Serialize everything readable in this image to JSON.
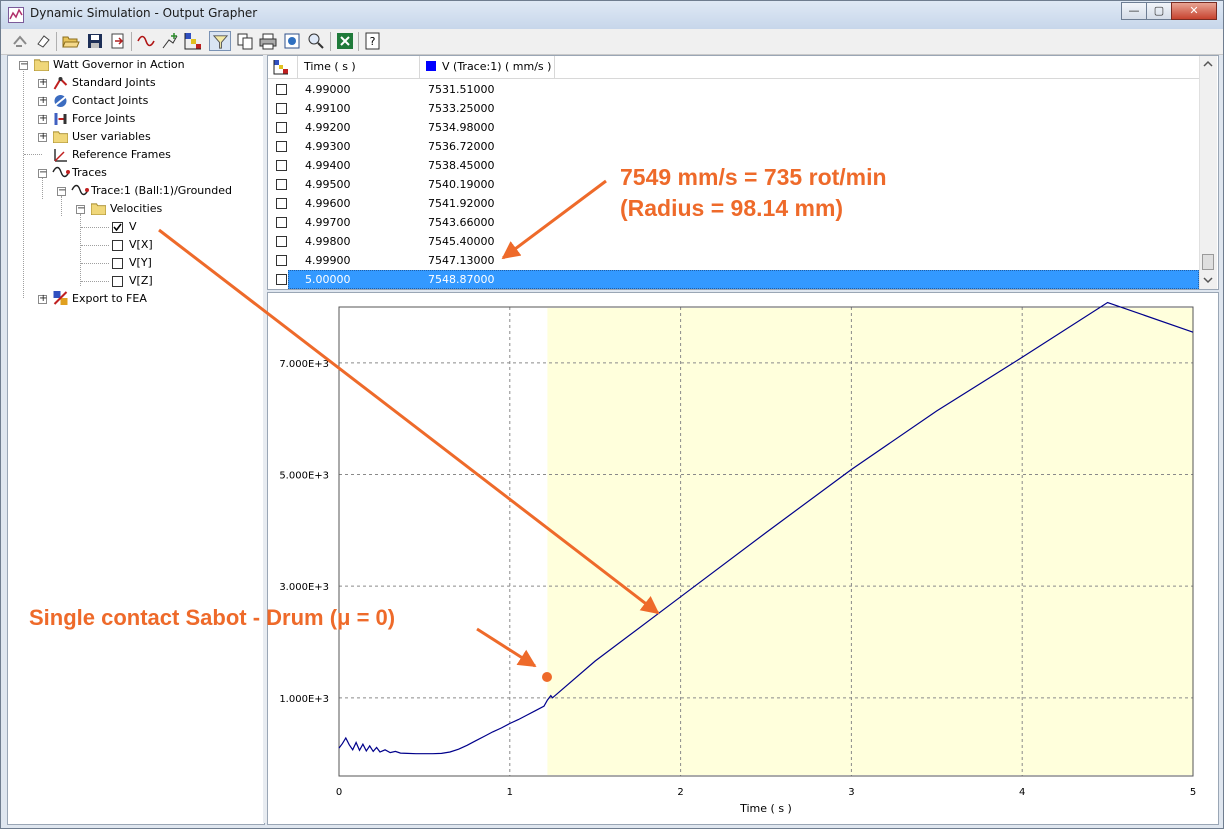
{
  "window": {
    "title": "Dynamic Simulation - Output Grapher",
    "controls": {
      "minimize": "—",
      "maximize": "▢",
      "close": "✕"
    }
  },
  "toolbar": {
    "icons": [
      "redo-icon",
      "eraser-icon",
      "open-folder-icon",
      "save-icon",
      "export-icon",
      "trace-icon",
      "add-variable-icon",
      "color-scale-icon",
      "filter-icon",
      "copy-icon",
      "print-icon",
      "zoom-fit-icon",
      "zoom-icon",
      "excel-icon",
      "help-icon"
    ],
    "active": "filter-icon"
  },
  "tree": {
    "root": "Watt Governor in Action",
    "items": [
      {
        "label": "Standard Joints",
        "icon": "standard-joints-icon"
      },
      {
        "label": "Contact Joints",
        "icon": "contact-joints-icon"
      },
      {
        "label": "Force Joints",
        "icon": "force-joints-icon"
      },
      {
        "label": "User variables",
        "icon": "folder-icon"
      },
      {
        "label": "Reference Frames",
        "icon": "reference-frame-icon"
      },
      {
        "label": "Traces",
        "icon": "trace-icon"
      },
      {
        "label": "Trace:1 (Ball:1)/Grounded",
        "icon": "trace-icon"
      },
      {
        "label": "Velocities",
        "icon": "folder-icon"
      },
      {
        "label": "V",
        "checked": true
      },
      {
        "label": "V[X]",
        "checked": false
      },
      {
        "label": "V[Y]",
        "checked": false
      },
      {
        "label": "V[Z]",
        "checked": false
      },
      {
        "label": "Export to FEA",
        "icon": "export-fea-icon"
      }
    ]
  },
  "table": {
    "columns": [
      "Time ( s )",
      "V (Trace:1) ( mm/s )"
    ],
    "series_color": "#0000ff",
    "rows": [
      {
        "time": "4.99000",
        "v": "7531.51000"
      },
      {
        "time": "4.99100",
        "v": "7533.25000"
      },
      {
        "time": "4.99200",
        "v": "7534.98000"
      },
      {
        "time": "4.99300",
        "v": "7536.72000"
      },
      {
        "time": "4.99400",
        "v": "7538.45000"
      },
      {
        "time": "4.99500",
        "v": "7540.19000"
      },
      {
        "time": "4.99600",
        "v": "7541.92000"
      },
      {
        "time": "4.99700",
        "v": "7543.66000"
      },
      {
        "time": "4.99800",
        "v": "7545.40000"
      },
      {
        "time": "4.99900",
        "v": "7547.13000"
      },
      {
        "time": "5.00000",
        "v": "7548.87000"
      }
    ],
    "selected_index": 10
  },
  "chart_data": {
    "type": "line",
    "title": "",
    "xlabel": "Time ( s )",
    "ylabel": "",
    "xlim": [
      0,
      5
    ],
    "ylim": [
      -400,
      8000
    ],
    "x_ticks": [
      "0",
      "1",
      "2",
      "3",
      "4",
      "5"
    ],
    "y_ticks": [
      {
        "value": 1000,
        "label": "1.000E+3"
      },
      {
        "value": 3000,
        "label": "3.000E+3"
      },
      {
        "value": 5000,
        "label": "5.000E+3"
      },
      {
        "value": 7000,
        "label": "7.000E+3"
      }
    ],
    "grid": true,
    "highlight_region": {
      "x_start": 1.22,
      "x_end": 5,
      "color": "#ffffdc"
    },
    "series": [
      {
        "color": "#00008b",
        "points": [
          [
            0,
            100
          ],
          [
            0.02,
            180
          ],
          [
            0.04,
            280
          ],
          [
            0.06,
            160
          ],
          [
            0.08,
            70
          ],
          [
            0.1,
            200
          ],
          [
            0.12,
            60
          ],
          [
            0.14,
            170
          ],
          [
            0.16,
            50
          ],
          [
            0.18,
            140
          ],
          [
            0.2,
            40
          ],
          [
            0.22,
            110
          ],
          [
            0.24,
            30
          ],
          [
            0.27,
            70
          ],
          [
            0.3,
            20
          ],
          [
            0.33,
            40
          ],
          [
            0.36,
            10
          ],
          [
            0.4,
            5
          ],
          [
            0.45,
            0
          ],
          [
            0.55,
            0
          ],
          [
            0.6,
            5
          ],
          [
            0.65,
            30
          ],
          [
            0.7,
            80
          ],
          [
            0.75,
            150
          ],
          [
            0.8,
            230
          ],
          [
            0.85,
            310
          ],
          [
            0.9,
            390
          ],
          [
            0.95,
            460
          ],
          [
            1.0,
            540
          ],
          [
            1.05,
            610
          ],
          [
            1.1,
            690
          ],
          [
            1.15,
            770
          ],
          [
            1.2,
            850
          ],
          [
            1.22,
            960
          ],
          [
            1.24,
            1040
          ],
          [
            1.25,
            1000
          ],
          [
            1.5,
            1660
          ],
          [
            2.0,
            2810
          ],
          [
            2.5,
            3960
          ],
          [
            3.0,
            5090
          ],
          [
            3.5,
            6140
          ],
          [
            4.0,
            7100
          ],
          [
            4.5,
            8080
          ],
          [
            5.0,
            7549
          ]
        ]
      }
    ]
  },
  "annotations": {
    "velocity_line1": "7549 mm/s = 735 rot/min",
    "velocity_line2": "(Radius = 98.14 mm)",
    "contact_note": "Single contact Sabot - Drum (μ = 0)",
    "color": "#ee6a2a"
  }
}
